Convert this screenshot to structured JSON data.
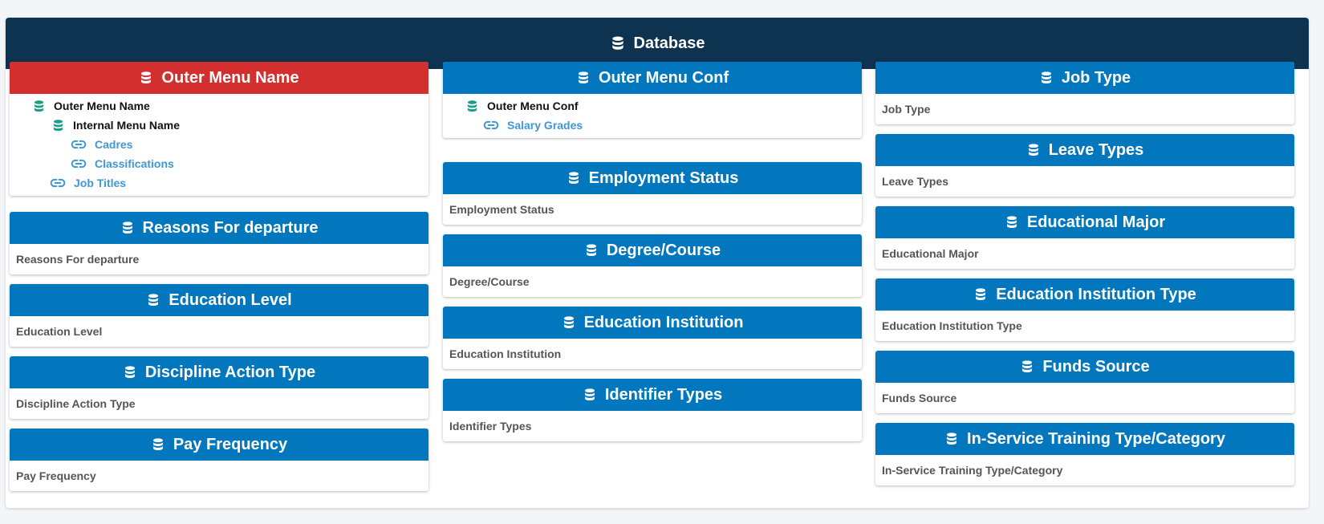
{
  "panel": {
    "title": "Database",
    "icon": "database-icon"
  },
  "colors": {
    "header_bg": "#0e3350",
    "card_header": "#0277bd",
    "card_header_active": "#d32f2f",
    "tree_icon": "#1a9e8a",
    "link": "#3f97d5"
  },
  "tree_cards": {
    "outer_menu_name": {
      "title": "Outer Menu Name",
      "outer": "Outer Menu Name",
      "internal": "Internal Menu Name",
      "links": [
        "Cadres",
        "Classifications"
      ],
      "outer_link": "Job Titles"
    },
    "outer_menu_conf": {
      "title": "Outer Menu Conf",
      "outer": "Outer Menu Conf",
      "link": "Salary Grades"
    }
  },
  "cards": {
    "reasons_departure": {
      "title": "Reasons For departure",
      "item": "Reasons For departure"
    },
    "education_level": {
      "title": "Education Level",
      "item": "Education Level"
    },
    "discipline_action_type": {
      "title": "Discipline Action Type",
      "item": "Discipline Action Type"
    },
    "pay_frequency": {
      "title": "Pay Frequency",
      "item": "Pay Frequency"
    },
    "employment_status": {
      "title": "Employment Status",
      "item": "Employment Status"
    },
    "degree_course": {
      "title": "Degree/Course",
      "item": "Degree/Course"
    },
    "education_institution": {
      "title": "Education Institution",
      "item": "Education Institution"
    },
    "identifier_types": {
      "title": "Identifier Types",
      "item": "Identifier Types"
    },
    "job_type": {
      "title": "Job Type",
      "item": "Job Type"
    },
    "leave_types": {
      "title": "Leave Types",
      "item": "Leave Types"
    },
    "educational_major": {
      "title": "Educational Major",
      "item": "Educational Major"
    },
    "education_institution_type": {
      "title": "Education Institution Type",
      "item": "Education Institution Type"
    },
    "funds_source": {
      "title": "Funds Source",
      "item": "Funds Source"
    },
    "in_service_training": {
      "title": "In-Service Training Type/Category",
      "item": "In-Service Training Type/Category"
    }
  }
}
